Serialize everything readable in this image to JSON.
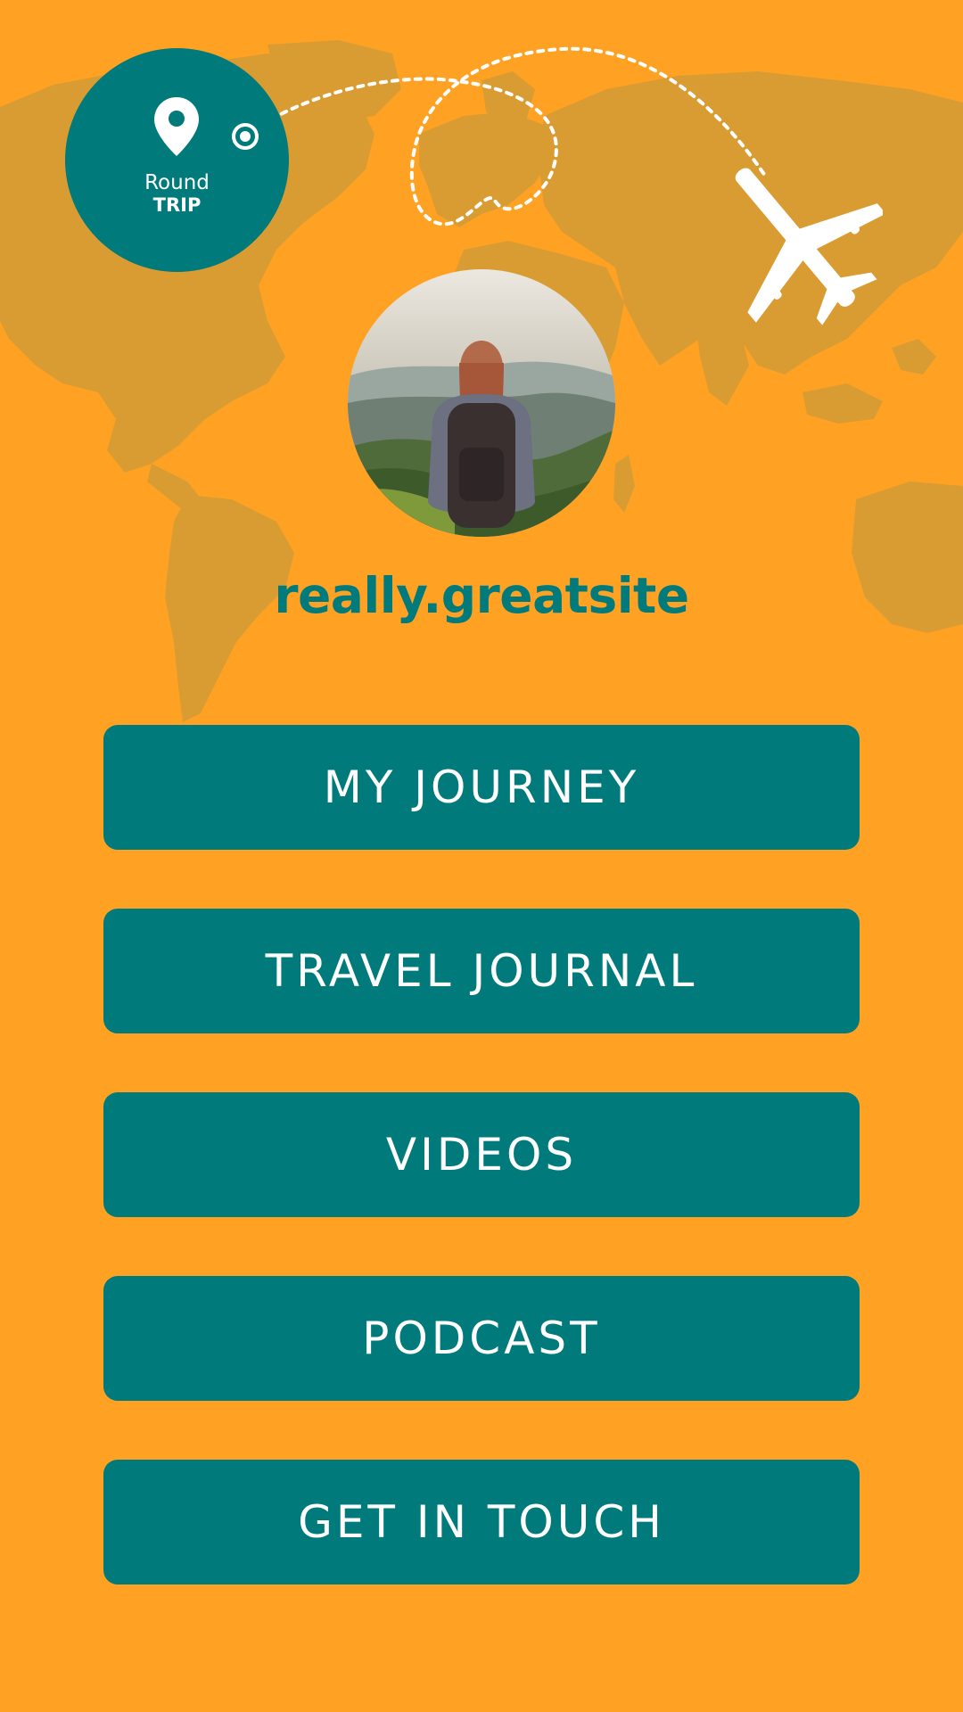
{
  "colors": {
    "background": "#FFA224",
    "map": "#D99C33",
    "accent": "#007A7A",
    "text_light": "#FFFFFF"
  },
  "badge": {
    "icon": "location-pin-icon",
    "line1": "Round",
    "line2": "TRIP"
  },
  "decor": {
    "plane_icon": "airplane-icon",
    "route": "dashed-flight-path"
  },
  "profile": {
    "image": "traveler-with-backpack-photo"
  },
  "site_name": "really.greatsite",
  "buttons": [
    {
      "label": "MY JOURNEY"
    },
    {
      "label": "TRAVEL JOURNAL"
    },
    {
      "label": "VIDEOS"
    },
    {
      "label": "PODCAST"
    },
    {
      "label": "GET IN TOUCH"
    }
  ]
}
